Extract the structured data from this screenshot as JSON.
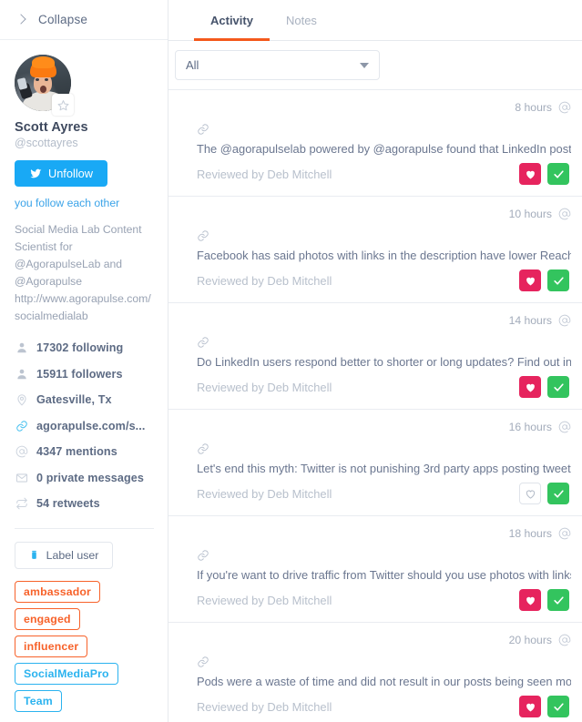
{
  "sidebar": {
    "collapse": {
      "label": "Collapse",
      "icon": "chevron-right-icon"
    },
    "profile": {
      "name": "Scott Ayres",
      "handle": "@scottayres",
      "avatar_badge_icon": "star-icon",
      "unfollow": {
        "label": "Unfollow",
        "icon": "twitter-icon",
        "color": "#19a9f5"
      },
      "mutual_text": "you follow each other",
      "bio": "Social Media Lab Content Scientist for @AgorapulseLab and @Agorapulse http://www.agorapulse.com/socialmedialab"
    },
    "stats": [
      {
        "icon": "user-icon",
        "text": "17302 following"
      },
      {
        "icon": "user-icon",
        "text": "15911 followers"
      },
      {
        "icon": "location-pin-icon",
        "text": "Gatesville, Tx"
      },
      {
        "icon": "link-icon",
        "text": "agorapulse.com/s..."
      },
      {
        "icon": "at-icon",
        "text": "4347 mentions"
      },
      {
        "icon": "envelope-icon",
        "text": "0 private messages"
      },
      {
        "icon": "retweet-icon",
        "text": "54 retweets"
      }
    ],
    "label_button": {
      "label": "Label user",
      "icon": "tag-icon"
    },
    "chips": [
      {
        "text": "ambassador",
        "color": "#f7622a",
        "style": "orange"
      },
      {
        "text": "engaged",
        "color": "#f7622a",
        "style": "orange"
      },
      {
        "text": "influencer",
        "color": "#f7622a",
        "style": "orange"
      },
      {
        "text": "SocialMediaPro",
        "color": "#2bb3ef",
        "style": "blue"
      },
      {
        "text": "Team",
        "color": "#2bb3ef",
        "style": "blue"
      }
    ]
  },
  "main": {
    "tabs": [
      {
        "label": "Activity",
        "active": true
      },
      {
        "label": "Notes",
        "active": false
      }
    ],
    "accent_color": "#f4591c",
    "filter": {
      "value": "All",
      "placeholder": "All",
      "icon": "chevron-down-icon"
    },
    "items": [
      {
        "time": "8 hours",
        "type_icon": "at-icon",
        "link_icon": "link-chain-icon",
        "text": "The @agorapulselab powered by @agorapulse found that LinkedIn posts with at",
        "reviewed": "Reviewed by Deb Mitchell",
        "heart": "filled",
        "check": "filled"
      },
      {
        "time": "10 hours",
        "type_icon": "at-icon",
        "link_icon": "link-chain-icon",
        "text": "Facebook has said photos with links in the description have lower Reach, but",
        "reviewed": "Reviewed by Deb Mitchell",
        "heart": "filled",
        "check": "filled"
      },
      {
        "time": "14 hours",
        "type_icon": "at-icon",
        "link_icon": "link-chain-icon",
        "text": "Do LinkedIn users respond better to shorter or long updates? Find out in this",
        "reviewed": "Reviewed by Deb Mitchell",
        "heart": "filled",
        "check": "filled"
      },
      {
        "time": "16 hours",
        "type_icon": "at-icon",
        "link_icon": "link-chain-icon",
        "text": "Let's end this myth: Twitter is not punishing 3rd party apps posting tweets!!! Via",
        "reviewed": "Reviewed by Deb Mitchell",
        "heart": "outline",
        "check": "filled"
      },
      {
        "time": "18 hours",
        "type_icon": "at-icon",
        "link_icon": "link-chain-icon",
        "text": "If you're want to drive traffic from Twitter should you use photos with links or just",
        "reviewed": "Reviewed by Deb Mitchell",
        "heart": "filled",
        "check": "filled"
      },
      {
        "time": "20 hours",
        "type_icon": "at-icon",
        "link_icon": "link-chain-icon",
        "text": "Pods were a waste of time and did not result in our posts being seen more by our",
        "reviewed": "Reviewed by Deb Mitchell",
        "heart": "filled",
        "check": "filled"
      }
    ]
  }
}
